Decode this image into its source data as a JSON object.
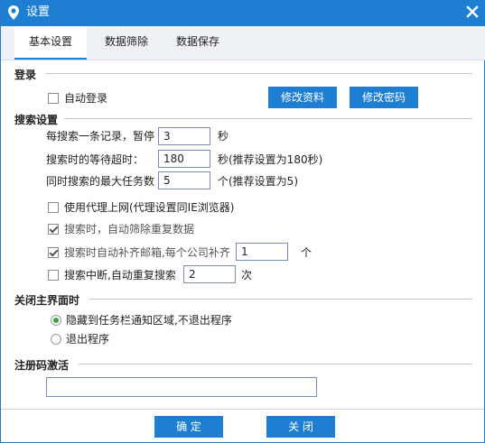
{
  "window": {
    "title": "设置",
    "app_icon": "location-pin-icon",
    "close_icon": "close-icon"
  },
  "tabs": [
    {
      "label": "基本设置",
      "active": true
    },
    {
      "label": "数据筛除",
      "active": false
    },
    {
      "label": "数据保存",
      "active": false
    }
  ],
  "login": {
    "section_title": "登录",
    "auto_login_label": "自动登录",
    "auto_login_checked": false,
    "edit_profile_label": "修改资料",
    "change_password_label": "修改密码"
  },
  "search": {
    "section_title": "搜索设置",
    "pause_label": "每搜索一条记录，暂停",
    "pause_value": "3",
    "pause_unit": "秒",
    "timeout_label": "搜索时的等待超时：",
    "timeout_value": "180",
    "timeout_unit": "秒(推荐设置为180秒)",
    "max_tasks_label": "同时搜索的最大任务数",
    "max_tasks_value": "5",
    "max_tasks_unit": "个(推荐设置为5)",
    "proxy_label": "使用代理上网(代理设置同IE浏览器)",
    "proxy_checked": false,
    "dedupe_label": "搜索时，自动筛除重复数据",
    "dedupe_checked": true,
    "fill_email_label": "搜索时自动补齐邮箱,每个公司补齐",
    "fill_email_checked": true,
    "fill_email_value": "1",
    "fill_email_unit": "个",
    "retry_label": "搜索中断,自动重复搜索",
    "retry_checked": false,
    "retry_value": "2",
    "retry_unit": "次"
  },
  "close_behavior": {
    "section_title": "关闭主界面时",
    "option_hide_label": "隐藏到任务栏通知区域,不退出程序",
    "option_exit_label": "退出程序",
    "selected": "hide"
  },
  "registration": {
    "section_title": "注册码激活",
    "code_value": ""
  },
  "footer": {
    "ok_label": "确 定",
    "close_label": "关 闭"
  },
  "colors": {
    "accent": "#1e7fd2",
    "radio_selected": "#3ba43b"
  }
}
